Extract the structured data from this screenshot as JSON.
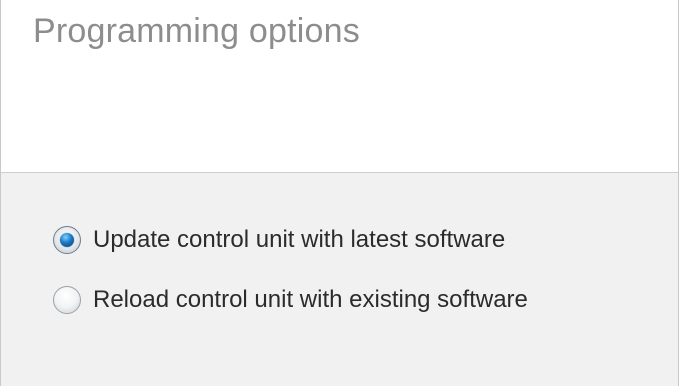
{
  "dialog": {
    "title": "Programming options",
    "options": [
      {
        "label": "Update control unit with latest software",
        "selected": true
      },
      {
        "label": "Reload control unit with existing software",
        "selected": false
      }
    ]
  },
  "colors": {
    "title_text": "#8d8d8d",
    "body_background": "#f1f1f1",
    "label_text": "#2b2b2b",
    "radio_selected": "#1a78c2"
  }
}
